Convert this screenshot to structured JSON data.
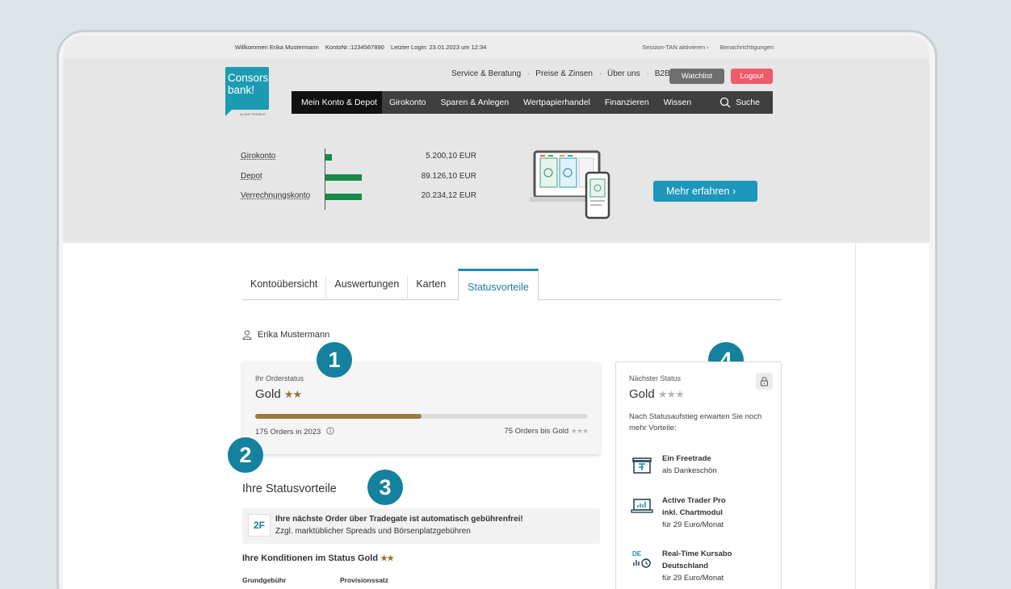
{
  "topbar": {
    "welcome": "Willkommen Erika Mustermann",
    "konto": "KontoNr.:1234567890",
    "login": "Letzter Login: 23.01.2023 um 12:34",
    "session": "Session-TAN aktivieren ›",
    "notifications": "Benachrichtigungen"
  },
  "logo": {
    "line1": "Consors",
    "line2": "bank!",
    "sub": "by BNP PARIBAS"
  },
  "topnav": {
    "items": [
      "Service & Beratung",
      "Preise & Zinsen",
      "Über uns",
      "B2B"
    ],
    "watchlist": "Watchlist",
    "logout": "Logout"
  },
  "mainnav": {
    "items": [
      "Mein Konto & Depot",
      "Girokonto",
      "Sparen & Anlegen",
      "Wertpapierhandel",
      "Finanzieren",
      "Wissen"
    ],
    "search": "Suche"
  },
  "accounts": [
    {
      "label": "Girokonto",
      "value": "5.200,10 EUR",
      "bar_fraction": 0.17
    },
    {
      "label": "Depot",
      "value": "89.126,10 EUR",
      "bar_fraction": 1.0
    },
    {
      "label": "Verrechnungskonto",
      "value": "20.234,12 EUR",
      "bar_fraction": 1.0
    }
  ],
  "promo": {
    "button": "Mehr erfahren ›"
  },
  "tabs": [
    "Kontoübersicht",
    "Auswertungen",
    "Karten",
    "Statusvorteile"
  ],
  "user": {
    "name": "Erika Mustermann"
  },
  "order_status": {
    "label": "Ihr Orderstatus",
    "value": "Gold",
    "stars": "★★",
    "progress": 0.5,
    "orders": "175 Orders in 2023",
    "orders_to_gold": "75 Orders bis Gold",
    "grey_stars": "★★★"
  },
  "badges": [
    "1",
    "2",
    "3",
    "4"
  ],
  "statusvorteile": {
    "title": "Ihre Statusvorteile",
    "benefit_icon": "2F",
    "benefit_line1": "Ihre nächste Order über Tradegate ist automatisch gebührenfrei!",
    "benefit_line2": "Zzgl. marktüblicher Spreads und Börsenplatzgebühren",
    "konditionen": "Ihre Konditionen im Status Gold",
    "konditionen_stars": "★★",
    "col1": "Grundgebühr",
    "col2": "Provisionssatz"
  },
  "next_status": {
    "label": "Nächster Status",
    "value": "Gold",
    "stars": "★★★",
    "desc": "Nach Statusaufstieg erwarten Sie noch mehr Vorteile:",
    "perks": [
      {
        "icon": "gift-icon",
        "title": "Ein Freetrade",
        "sub": "als Dankeschön",
        "title2": ""
      },
      {
        "icon": "laptop-chart-icon",
        "title": "Active Trader Pro",
        "title2": "inkl. Chartmodul",
        "sub": "für 29 Euro/Monat"
      },
      {
        "icon": "realtime-de-icon",
        "title": "Real-Time Kursabo",
        "title2": "Deutschland",
        "sub": "für 29 Euro/Monat"
      }
    ]
  },
  "colors": {
    "accent": "#1d8ab2",
    "gold": "#9a7433",
    "bar": "#1a8a4a",
    "logout": "#ef5b6a"
  }
}
